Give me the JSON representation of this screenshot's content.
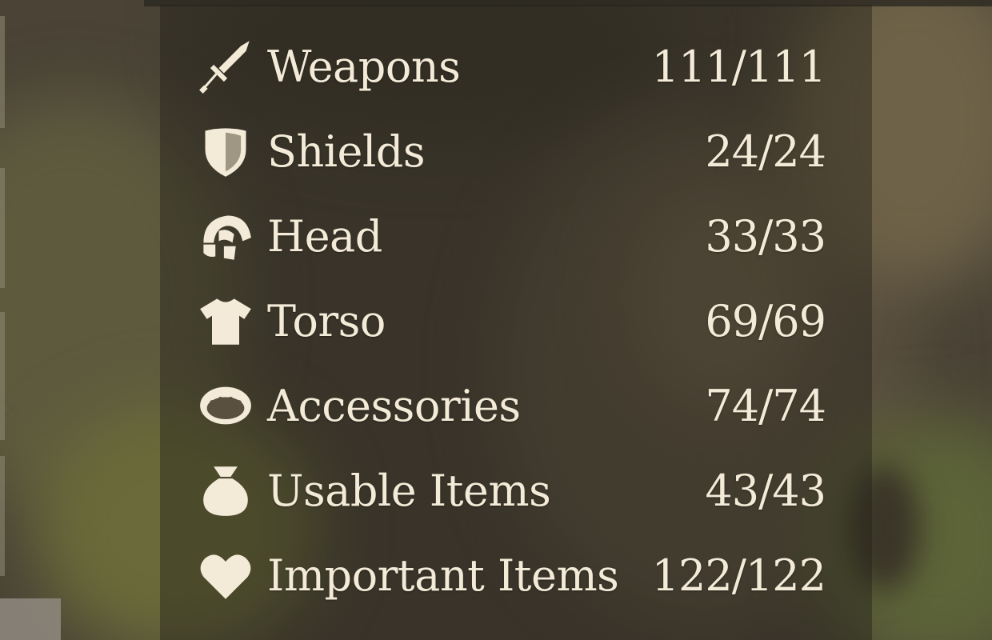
{
  "colors": {
    "text": "#f3ead7",
    "icon": "#f3ead7",
    "panel": "#221e18"
  },
  "categories": [
    {
      "icon": "sword-icon",
      "label": "Weapons",
      "count": "111/111"
    },
    {
      "icon": "shield-icon",
      "label": "Shields",
      "count": "24/24"
    },
    {
      "icon": "helmet-icon",
      "label": "Head",
      "count": "33/33"
    },
    {
      "icon": "tunic-icon",
      "label": "Torso",
      "count": "69/69"
    },
    {
      "icon": "ring-icon",
      "label": "Accessories",
      "count": "74/74"
    },
    {
      "icon": "pouch-icon",
      "label": "Usable Items",
      "count": "43/43"
    },
    {
      "icon": "heart-icon",
      "label": "Important Items",
      "count": "122/122"
    }
  ]
}
